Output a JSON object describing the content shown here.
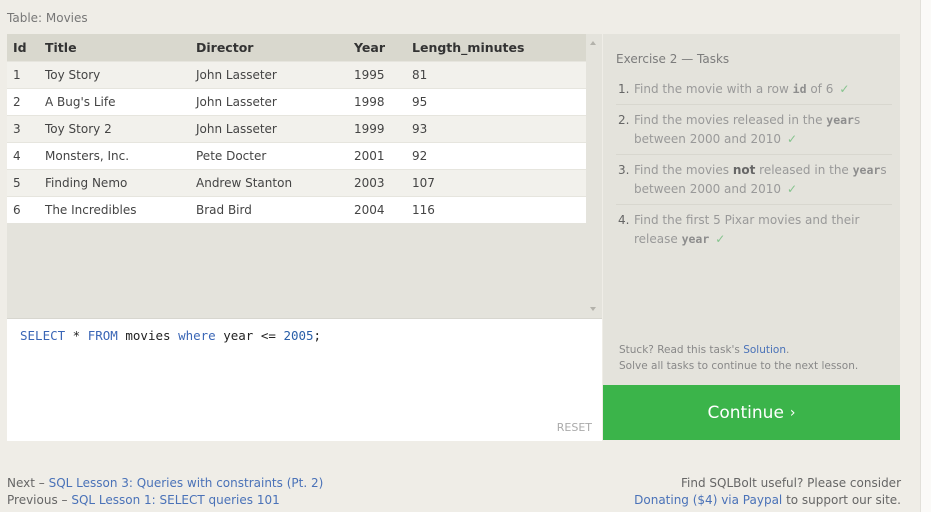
{
  "table_caption": "Table: Movies",
  "results": {
    "columns": [
      "Id",
      "Title",
      "Director",
      "Year",
      "Length_minutes"
    ],
    "rows": [
      [
        "1",
        "Toy Story",
        "John Lasseter",
        "1995",
        "81"
      ],
      [
        "2",
        "A Bug's Life",
        "John Lasseter",
        "1998",
        "95"
      ],
      [
        "3",
        "Toy Story 2",
        "John Lasseter",
        "1999",
        "93"
      ],
      [
        "4",
        "Monsters, Inc.",
        "Pete Docter",
        "2001",
        "92"
      ],
      [
        "5",
        "Finding Nemo",
        "Andrew Stanton",
        "2003",
        "107"
      ],
      [
        "6",
        "The Incredibles",
        "Brad Bird",
        "2004",
        "116"
      ]
    ]
  },
  "editor": {
    "query": {
      "kw_select": "SELECT",
      "star": " * ",
      "kw_from": "FROM",
      "table": " movies ",
      "kw_where": "where",
      "column": " year <= ",
      "number": "2005",
      "end": ";"
    },
    "reset_label": "RESET"
  },
  "exercise": {
    "heading": "Exercise 2 — Tasks",
    "tasks": [
      {
        "num": "1.",
        "a": "Find the movie with a row ",
        "code": "id",
        "b": " of 6",
        "check": "✓"
      },
      {
        "num": "2.",
        "a": "Find the movies released in the ",
        "code": "year",
        "b": "s between 2000 and 2010",
        "check": "✓"
      },
      {
        "num": "3.",
        "a": "Find the movies ",
        "bold": "not",
        "a2": " released in the ",
        "code": "year",
        "b": "s between 2000 and 2010",
        "check": "✓"
      },
      {
        "num": "4.",
        "a": "Find the first 5 Pixar movies and their release ",
        "code": "year",
        "b": "",
        "check": "✓"
      }
    ],
    "stuck_prefix": "Stuck? Read this task's ",
    "solution_link": "Solution",
    "stuck_suffix": ".",
    "solve_all": "Solve all tasks to continue to the next lesson.",
    "continue_label": "Continue",
    "continue_chevron": "›"
  },
  "footer": {
    "next_prefix": "Next – ",
    "next_link": "SQL Lesson 3: Queries with constraints (Pt. 2)",
    "prev_prefix": "Previous – ",
    "prev_link": "SQL Lesson 1: SELECT queries 101",
    "support_line1": "Find SQLBolt useful? Please consider",
    "donate_link": "Donating ($4) via Paypal",
    "support_suffix": " to support our site."
  }
}
